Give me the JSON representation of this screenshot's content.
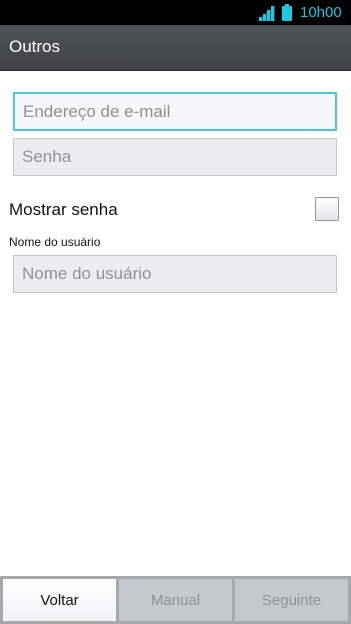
{
  "status_bar": {
    "time": "10h00",
    "accent_color": "#1ec8e0",
    "icons": [
      "signal-icon",
      "battery-icon"
    ]
  },
  "header": {
    "title": "Outros"
  },
  "form": {
    "email": {
      "value": "",
      "placeholder": "Endereço de e-mail"
    },
    "password": {
      "value": "",
      "placeholder": "Senha"
    },
    "show_password": {
      "label": "Mostrar senha",
      "checked": false
    },
    "username": {
      "label": "Nome do usuário",
      "value": "",
      "placeholder": "Nome do usuário"
    }
  },
  "footer": {
    "back_label": "Voltar",
    "manual_label": "Manual",
    "next_label": "Seguinte"
  },
  "colors": {
    "focus_border": "#4cc6dc",
    "title_bar": "#474b4f"
  }
}
